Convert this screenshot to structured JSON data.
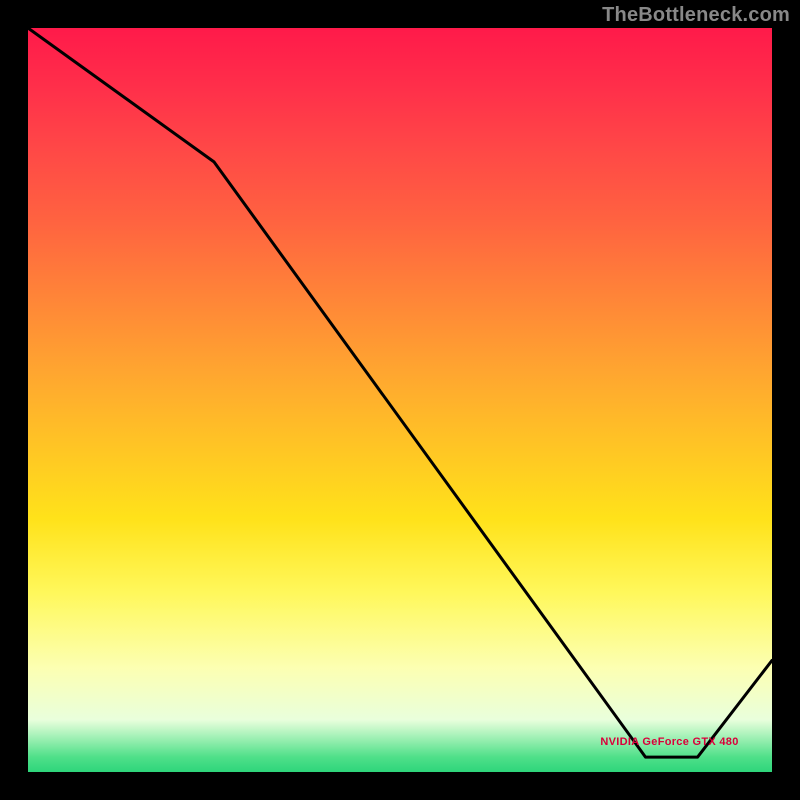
{
  "attribution": "TheBottleneck.com",
  "annotation": {
    "text": "NVIDIA GeForce GTX 480"
  },
  "chart_data": {
    "type": "line",
    "title": "",
    "xlabel": "",
    "ylabel": "",
    "xlim": [
      0,
      100
    ],
    "ylim": [
      0,
      100
    ],
    "grid": false,
    "legend": false,
    "description": "Black curve descends from top-left, kinks, continues to a minimum near x≈85, then rises toward right edge. Background is vertical red→yellow→green gradient (bottleneck chart style).",
    "series": [
      {
        "name": "curve",
        "x": [
          0,
          25,
          83,
          90,
          100
        ],
        "y": [
          100,
          82,
          2,
          2,
          15
        ]
      }
    ],
    "annotation_point": {
      "x": 85,
      "y": 4,
      "label": "NVIDIA GeForce GTX 480"
    }
  }
}
